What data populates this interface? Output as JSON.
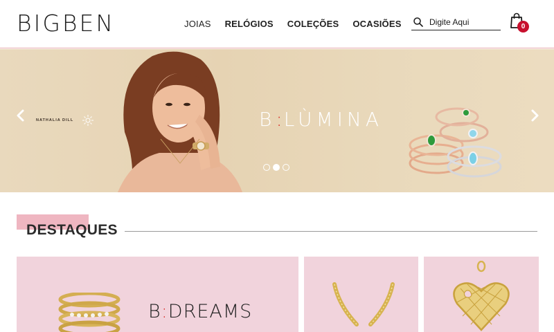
{
  "header": {
    "logo": "BIGBEN",
    "nav": [
      "JOIAS",
      "RELÓGIOS",
      "COLEÇÕES",
      "OCASIÕES"
    ],
    "search_placeholder": "Digite Aqui",
    "cart_count": "0"
  },
  "banner": {
    "signature": "NATHALIA DILL",
    "brand_letter": "B",
    "brand_colon": ":",
    "brand_name": "LÙMINA",
    "slide_count": 3,
    "active_slide": 2
  },
  "highlights": {
    "title": "DESTAQUES",
    "card1_brand_letter": "B",
    "card1_brand_colon": ":",
    "card1_brand_name": "DREAMS"
  },
  "colors": {
    "accent_red": "#c8102e",
    "banner_bg": "#e9d9bd",
    "card_pink": "#f1d3dc",
    "title_highlight": "#efb6c1"
  }
}
